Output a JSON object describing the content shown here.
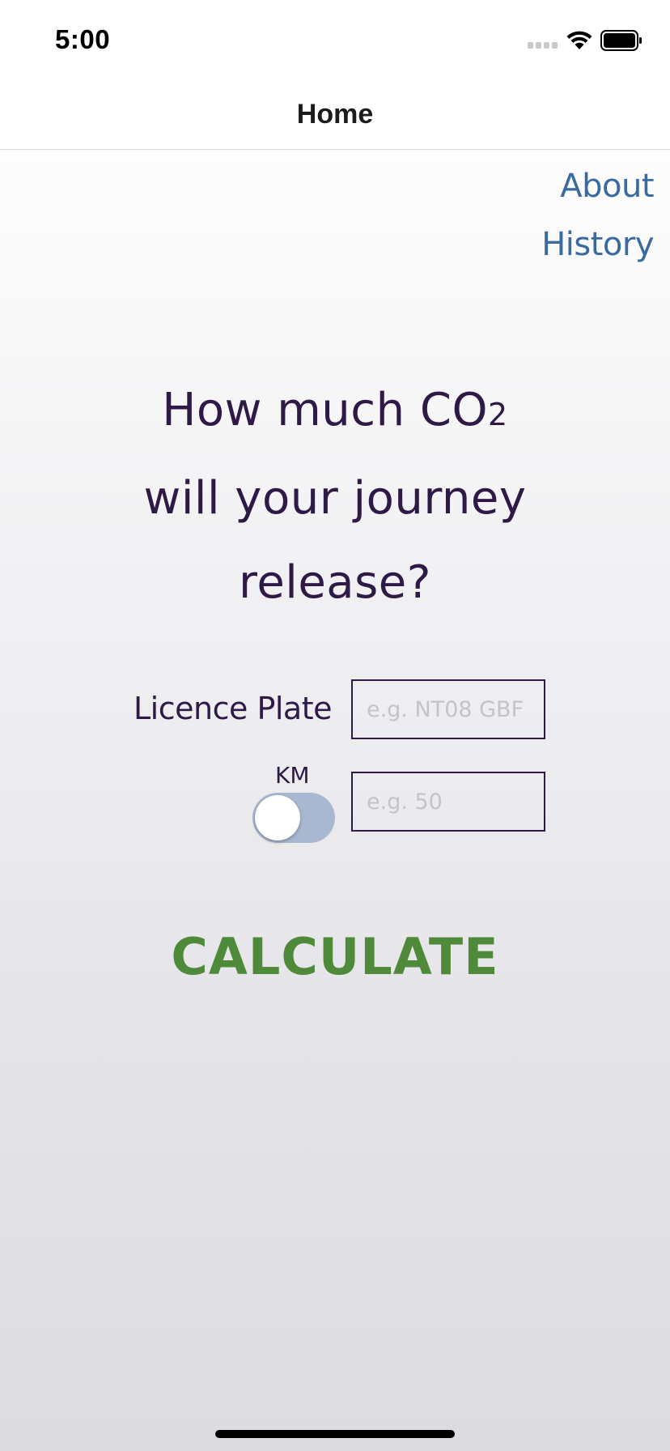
{
  "status_bar": {
    "time": "5:00",
    "icons": [
      "cellular-signal-icon",
      "wifi-icon",
      "battery-icon"
    ]
  },
  "nav": {
    "title": "Home"
  },
  "links": {
    "about": "About",
    "history": "History"
  },
  "headline": {
    "line1": "How much CO",
    "subscript": "2",
    "line2": "will your journey",
    "line3": "release?"
  },
  "form": {
    "plate_label": "Licence Plate",
    "plate_placeholder": "e.g. NT08 GBF",
    "plate_value": "",
    "unit_label": "KM",
    "unit_toggle_on": false,
    "distance_placeholder": "e.g. 50",
    "distance_value": ""
  },
  "actions": {
    "calculate_label": "CALCULATE"
  },
  "colors": {
    "headline": "#2f1a47",
    "link": "#3b6aa0",
    "calculate": "#4e8a3a",
    "toggle_track": "#a8b8d0",
    "field_border": "#2f1a47",
    "placeholder": "#c4c3c8"
  }
}
